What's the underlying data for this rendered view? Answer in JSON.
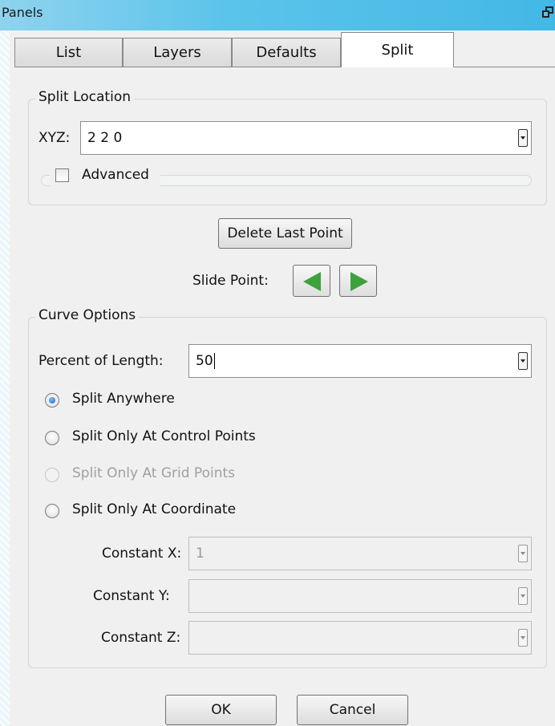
{
  "window": {
    "title": "Panels"
  },
  "tabs": [
    {
      "label": "List",
      "active": false
    },
    {
      "label": "Layers",
      "active": false
    },
    {
      "label": "Defaults",
      "active": false
    },
    {
      "label": "Split",
      "active": true
    }
  ],
  "split_location": {
    "legend": "Split Location",
    "xyz_label": "XYZ:",
    "xyz_value": "2 2 0",
    "advanced_label": "Advanced",
    "advanced_checked": false
  },
  "actions": {
    "delete_last_point": "Delete Last Point",
    "slide_point_label": "Slide Point:"
  },
  "curve_options": {
    "legend": "Curve Options",
    "percent_label": "Percent of Length:",
    "percent_value": "50",
    "radios": [
      {
        "label": "Split Anywhere",
        "checked": true,
        "enabled": true
      },
      {
        "label": "Split Only At Control Points",
        "checked": false,
        "enabled": true
      },
      {
        "label": "Split Only At Grid Points",
        "checked": false,
        "enabled": false
      },
      {
        "label": "Split Only At Coordinate",
        "checked": false,
        "enabled": true
      }
    ],
    "constant_x_label": "Constant X:",
    "constant_x_value": "1",
    "constant_y_label": "Constant Y:",
    "constant_y_value": "",
    "constant_z_label": "Constant Z:",
    "constant_z_value": ""
  },
  "footer": {
    "ok": "OK",
    "cancel": "Cancel"
  },
  "colors": {
    "accent": "#43b8e6",
    "arrow_green": "#3da23d",
    "radio_blue": "#1d5fb7"
  }
}
